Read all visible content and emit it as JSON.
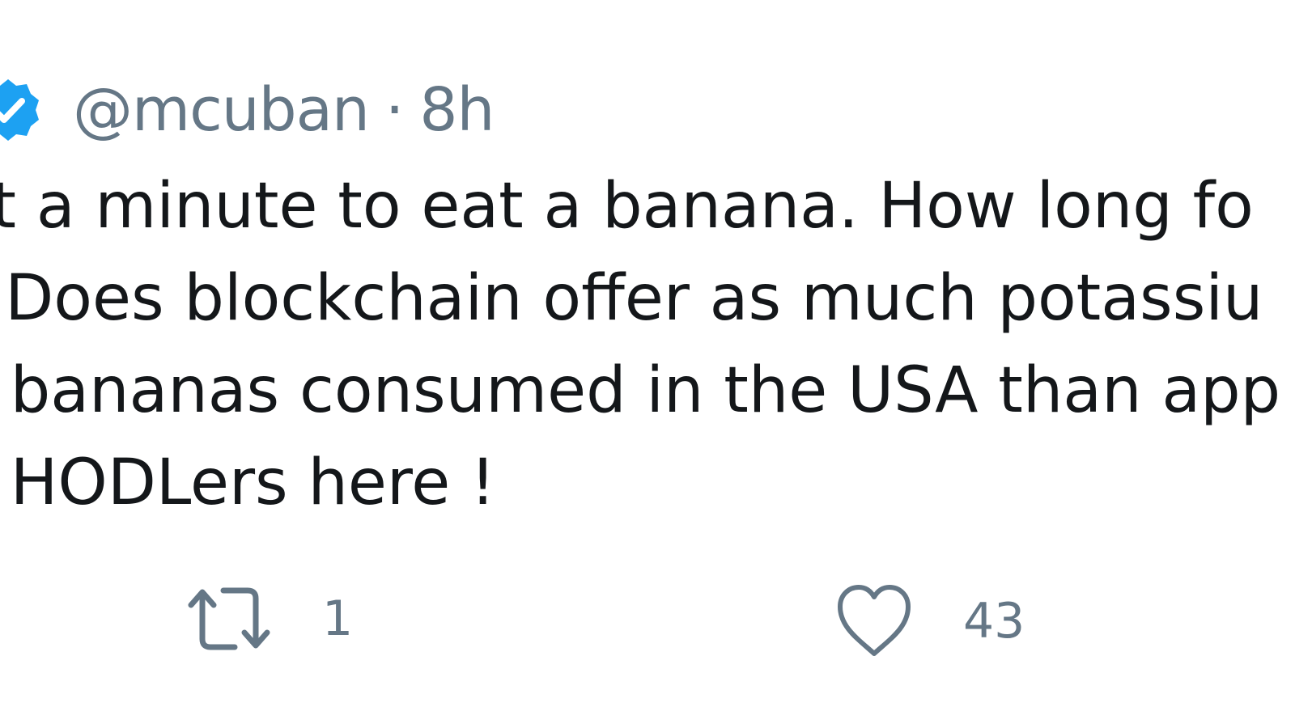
{
  "tweet": {
    "handle": "@mcuban",
    "separator": "·",
    "time": "8h",
    "lines": [
      "ut a minute to eat a banana. How long fo",
      "? Does blockchain offer as much potassiu",
      "e bananas consumed in the USA than app",
      "e HODLers here !"
    ]
  },
  "actions": {
    "retweet": {
      "icon": "retweet-icon",
      "count": "1"
    },
    "like": {
      "icon": "heart-icon",
      "count": "43"
    }
  },
  "colors": {
    "verified": "#1da1f2",
    "muted": "#657786",
    "text": "#14171a"
  }
}
